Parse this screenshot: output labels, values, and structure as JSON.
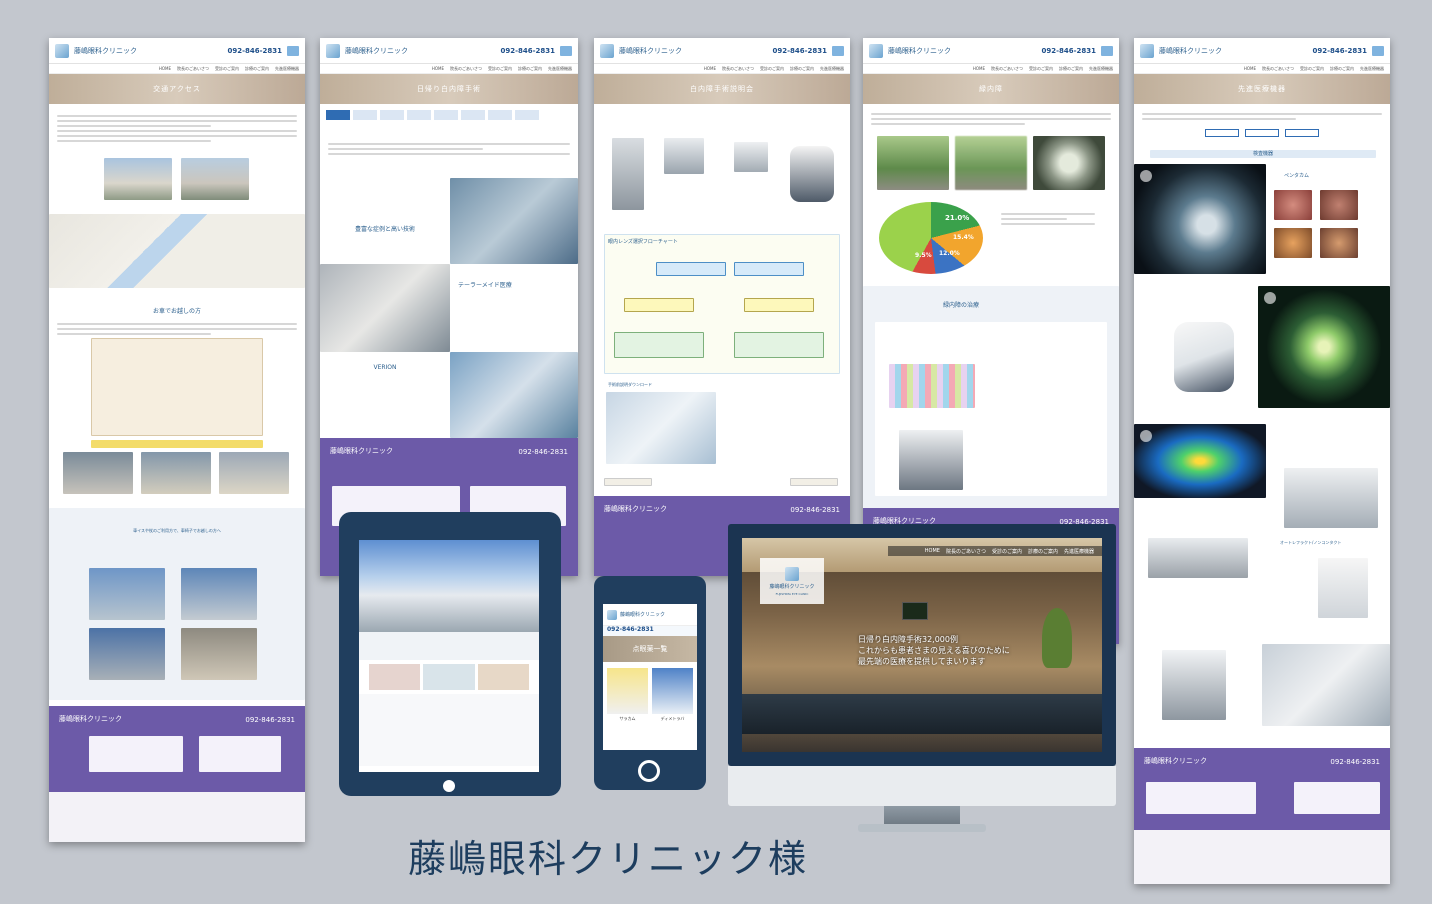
{
  "caption": "藤嶋眼科クリニック様",
  "clinic": {
    "name_ja": "藤嶋眼科クリニック",
    "name_en": "FUJISHIMA EYE CLINIC",
    "tel": "092-846-2831"
  },
  "nav": [
    "HOME",
    "院長のごあいさつ",
    "受診のご案内",
    "診療のご案内",
    "先進医療機器"
  ],
  "pages": {
    "access": {
      "hero": "交通アクセス",
      "section_car": "お車でお越しの方",
      "section_bus": "車イスや杖のご利用方で、車椅子でお越しの方へ"
    },
    "surgery": {
      "hero": "日帰り白内障手術",
      "callout1": "豊富な症例と高い技術",
      "callout2": "テーラーメイド医療",
      "callout3": "VERION"
    },
    "lens": {
      "hero": "白内障手術説明会",
      "section": "眼内レンズ選択フローチャート",
      "download": "手術前説明ダウンロード"
    },
    "glaucoma": {
      "hero": "緑内障",
      "stat1": "21.0%",
      "stat2": "15.4%",
      "stat3": "12.0%",
      "stat4": "9.5%",
      "section": "緑内障の治療"
    },
    "equipment": {
      "hero": "先進医療機器",
      "section": "検査機器",
      "item1": "ペンタカム",
      "item2": "オートレフラクト/ノンコンタクト"
    }
  },
  "monitor": {
    "hero_line1": "日帰り白内障手術32,000例",
    "hero_line2": "これからも患者さまの見える喜びのために",
    "hero_line3": "最先端の医療を提供してまいります"
  },
  "phone": {
    "heading": "点眼薬一覧",
    "item1": "サラカム",
    "item2": "ディメトラバ"
  },
  "colors": {
    "footer": "#6c5aa8",
    "device": "#203e5e",
    "background": "#c3c7ce",
    "accent": "#2b5f8d"
  }
}
